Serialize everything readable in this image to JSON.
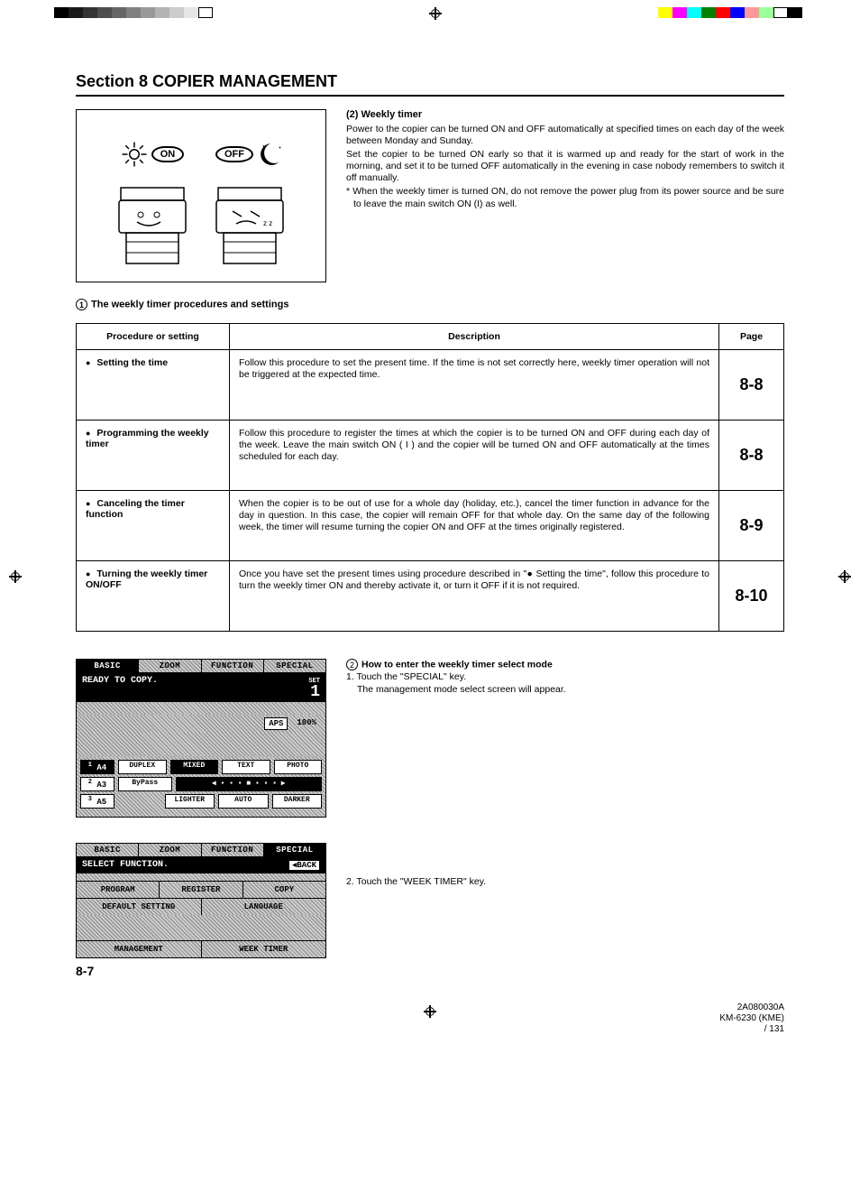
{
  "calibration_colors_left": [
    "#000000",
    "#1a1a1a",
    "#333333",
    "#4d4d4d",
    "#666666",
    "#808080",
    "#999999",
    "#b3b3b3",
    "#cccccc",
    "#e6e6e6",
    "#ffffff"
  ],
  "calibration_colors_right": [
    "#ffff00",
    "#ff00ff",
    "#00ffff",
    "#008000",
    "#ff0000",
    "#0000ff",
    "#ff9999",
    "#99ff99",
    "#ffffff",
    "#000000"
  ],
  "section_title": "Section 8  COPIER MANAGEMENT",
  "illus": {
    "on_label": "ON",
    "off_label": "OFF"
  },
  "intro": {
    "heading": "(2) Weekly timer",
    "p1": "Power to the copier can be turned ON and OFF automatically at specified times on each day of the week between Monday and Sunday.",
    "p2": "Set the copier to be turned ON early so that it is warmed up and ready for the start of work in the morning, and set it to be turned OFF automatically in the evening in case nobody remembers to switch it off manually.",
    "note": "* When the weekly timer is turned ON, do not remove the power plug from its power source and be sure to leave the main switch ON (I) as well."
  },
  "proc_heading_num": "1",
  "proc_heading": "The weekly timer procedures and settings",
  "table": {
    "headers": {
      "col1": "Procedure or setting",
      "col2": "Description",
      "col3": "Page"
    },
    "rows": [
      {
        "name": "Setting the time",
        "desc": "Follow this procedure to set the present time. If the time is not set correctly here, weekly timer operation will not be triggered at the expected time.",
        "page": "8-8"
      },
      {
        "name": "Programming the weekly timer",
        "desc": "Follow this procedure to register the times at which the copier is to be turned ON and OFF during each day of the week. Leave the main switch ON ( I ) and the copier will be turned ON and OFF automatically at the times scheduled for each day.",
        "page": "8-8"
      },
      {
        "name": "Canceling the timer function",
        "desc": "When the copier is to be out of use for a whole day (holiday, etc.), cancel the timer function in advance for the day in question. In this case, the copier will remain OFF for that whole day. On the same day of the following week, the timer will resume turning the copier ON and OFF at the times originally registered.",
        "page": "8-9"
      },
      {
        "name": "Turning the weekly timer ON/OFF",
        "desc": "Once you have set the present times using procedure described in \"● Setting the time\", follow this procedure to turn the weekly timer ON and thereby activate it, or turn it OFF if it is not required.",
        "page": "8-10"
      }
    ]
  },
  "panel1": {
    "tabs": [
      "BASIC",
      "ZOOM",
      "FUNCTION",
      "SPECIAL"
    ],
    "status": "READY TO COPY.",
    "set_label": "SET",
    "set_num": "1",
    "aps": "APS",
    "zoom_pct": "100%",
    "sizes": [
      "A4",
      "A3",
      "A5"
    ],
    "row1_btns": [
      "DUPLEX",
      "MIXED",
      "TEXT",
      "PHOTO"
    ],
    "row2_btns": [
      "ByPass"
    ],
    "row3_btns": [
      "LIGHTER",
      "AUTO",
      "DARKER"
    ]
  },
  "panel2": {
    "tabs": [
      "BASIC",
      "ZOOM",
      "FUNCTION",
      "SPECIAL"
    ],
    "status": "SELECT FUNCTION.",
    "back": "BACK",
    "rows": [
      [
        "PROGRAM",
        "REGISTER",
        "COPY"
      ],
      [
        "DEFAULT SETTING",
        "LANGUAGE"
      ],
      [
        "MANAGEMENT",
        "WEEK TIMER"
      ]
    ]
  },
  "instr2_num": "2",
  "instr2_head": "How to enter the weekly timer select mode",
  "instr2_step1a": "1. Touch the \"SPECIAL\" key.",
  "instr2_step1b": "The management mode select screen will appear.",
  "instr2_step2": "2. Touch the \"WEEK TIMER\" key.",
  "page_number": "8-7",
  "footer": {
    "code": "2A080030A",
    "model": "KM-6230 (KME)",
    "frag": "/ 131"
  }
}
